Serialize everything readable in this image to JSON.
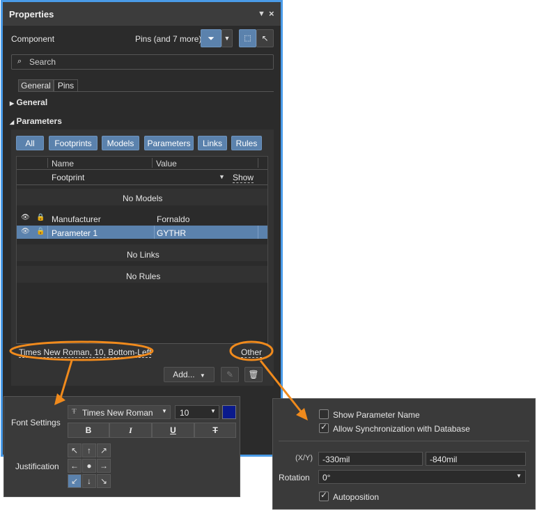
{
  "panel": {
    "title": "Properties",
    "component_label": "Component",
    "filter_text": "Pins (and 7 more)",
    "search_placeholder": "Search",
    "tabs": [
      "General",
      "Pins"
    ],
    "sections": {
      "general": "General",
      "parameters": "Parameters"
    },
    "filter_buttons": [
      "All",
      "Footprints",
      "Models",
      "Parameters",
      "Links",
      "Rules"
    ],
    "columns": {
      "name": "Name",
      "value": "Value"
    },
    "footprint_row": {
      "name": "Footprint",
      "link": "Show"
    },
    "no_models": "No Models",
    "rows": [
      {
        "name": "Manufacturer",
        "value": "Fornaldo"
      },
      {
        "name": "Parameter 1",
        "value": "GYTHR"
      }
    ],
    "no_links": "No Links",
    "no_rules": "No Rules",
    "font_link": "Times New Roman, 10, Bottom-Left",
    "other_link": "Other",
    "add_button": "Add...",
    "colors": {
      "accent": "#4a9be8",
      "button_blue": "#5b82ad",
      "highlight": "#f08a1c",
      "selected_row": "#5b82ad"
    }
  },
  "font_popup": {
    "font_settings_label": "Font Settings",
    "font_name": "Times New Roman",
    "font_size": "10",
    "color_swatch": "#0a1a8c",
    "format_buttons": [
      "B",
      "I",
      "U",
      "T"
    ],
    "justification_label": "Justification",
    "justification_glyphs": [
      "↖",
      "↑",
      "↗",
      "←",
      "●",
      "→",
      "↙",
      "↓",
      "↘"
    ],
    "selected_justification": "bottom-left"
  },
  "other_popup": {
    "show_param_name": "Show Parameter Name",
    "allow_sync": "Allow Synchronization with Database",
    "xy_label": "(X/Y)",
    "x_value": "-330mil",
    "y_value": "-840mil",
    "rotation_label": "Rotation",
    "rotation_value": "0°",
    "autoposition": "Autoposition"
  }
}
